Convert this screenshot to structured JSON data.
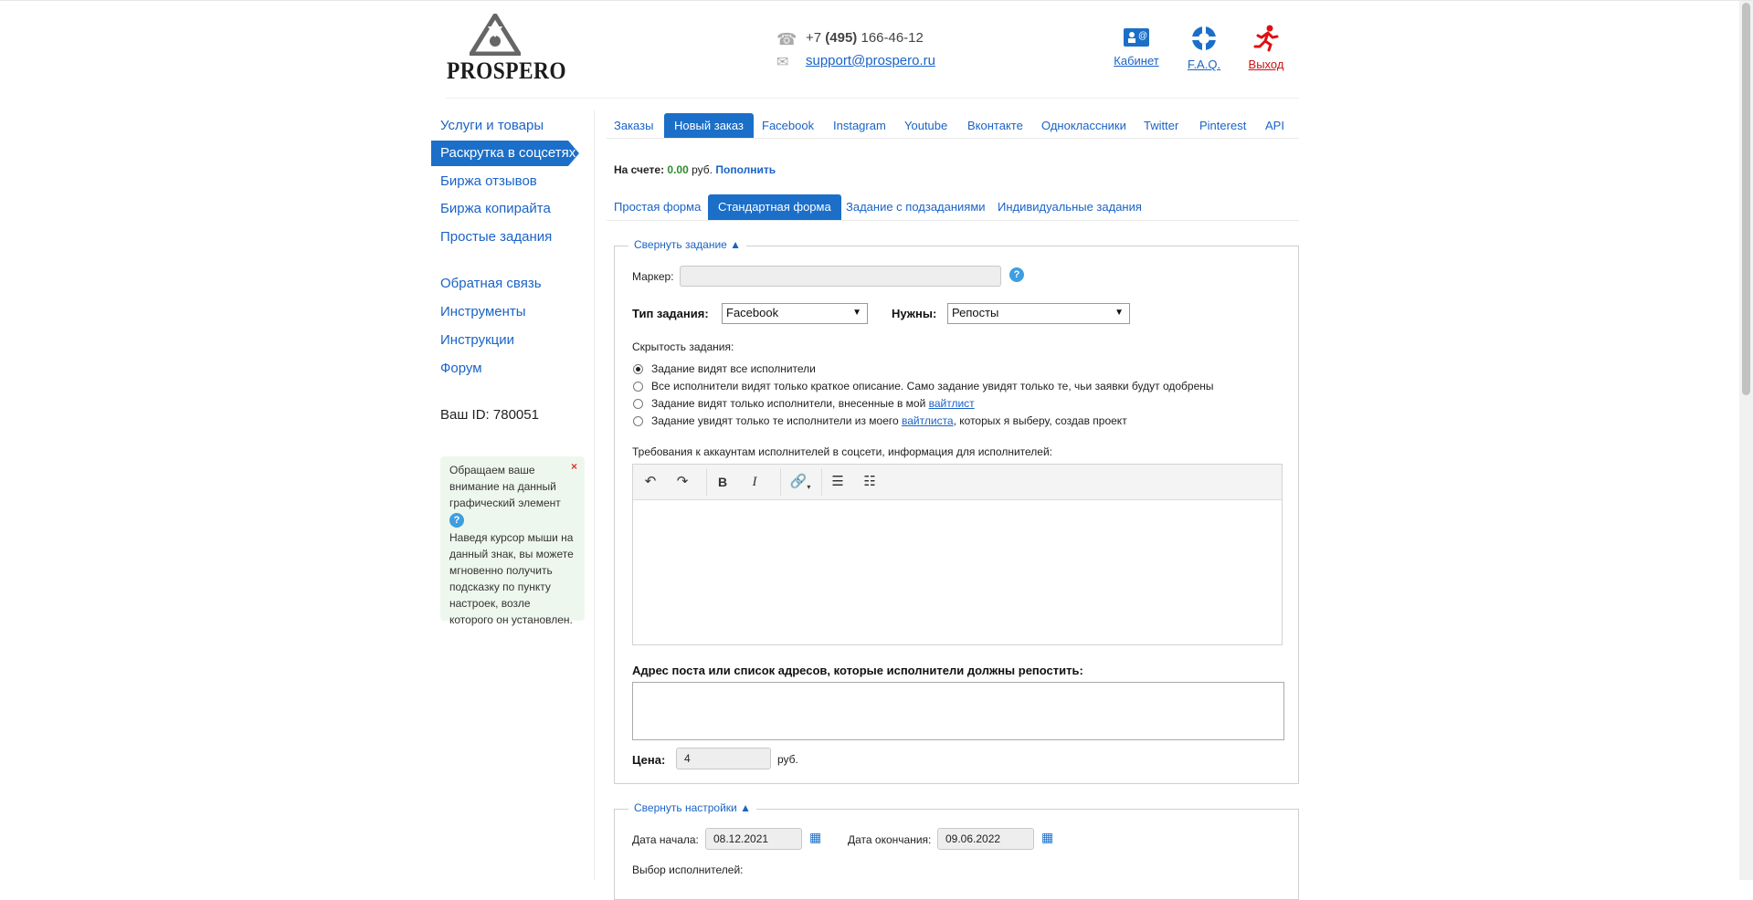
{
  "header": {
    "logo_text": "PROSPERO",
    "phone_prefix": "+7 ",
    "phone_code": "(495)",
    "phone_number": " 166-46-12",
    "email": "support@prospero.ru",
    "links": {
      "cabinet": "Кабинет",
      "faq": "F.A.Q.",
      "logout": "Выход"
    }
  },
  "sidebar": {
    "items": [
      "Услуги и товары",
      "Раскрутка в соцсетях",
      "Биржа отзывов",
      "Биржа копирайта",
      "Простые задания"
    ],
    "items2": [
      "Обратная связь",
      "Инструменты",
      "Инструкции",
      "Форум"
    ],
    "your_id": "Ваш ID: 780051",
    "tip_text": "Обращаем ваше внимание на данный графический элемент",
    "tip_body": "Наведя курсор мыши на данный знак, вы можете мгновенно получить подсказку по пункту настроек, возле которого он установлен.",
    "tip_close": "×"
  },
  "tabs": [
    "Заказы",
    "Новый заказ",
    "Facebook",
    "Instagram",
    "Youtube",
    "Вконтакте",
    "Одноклассники",
    "Twitter",
    "Pinterest",
    "API"
  ],
  "balance": {
    "label": "На счете:",
    "amount": "0.00",
    "currency": "руб.",
    "topup": "Пополнить"
  },
  "form_tabs": [
    "Простая форма",
    "Стандартная форма",
    "Задание с подзаданиями",
    "Индивидуальные задания"
  ],
  "task": {
    "legend": "Свернуть задание ▲",
    "marker_label": "Маркер:",
    "marker_value": "",
    "task_type_label": "Тип задания:",
    "task_type_value": "Facebook",
    "need_label": "Нужны:",
    "need_value": "Репосты",
    "visibility_label": "Скрытость задания:",
    "radios": [
      {
        "text": "Задание видят все исполнители",
        "link": "",
        "after": "",
        "checked": true
      },
      {
        "text": "Все исполнители видят только краткое описание. Само задание увидят только те, чьи заявки будут одобрены",
        "link": "",
        "after": "",
        "checked": false
      },
      {
        "text": "Задание видят только исполнители, внесенные в мой ",
        "link": "вайтлист",
        "after": "",
        "checked": false
      },
      {
        "text": "Задание увидят только те исполнители из моего ",
        "link": "вайтлиста",
        "after": ", которых я выберу, создав проект",
        "checked": false
      }
    ],
    "requirements_label": "Требования к аккаунтам исполнителей в соцсети, информация для исполнителей:",
    "repost_label": "Адрес поста или список адресов, которые исполнители должны репостить:",
    "price_label": "Цена:",
    "price_value": "4",
    "price_currency": "руб."
  },
  "settings": {
    "legend": "Свернуть настройки ▲",
    "start_label": "Дата начала:",
    "start_value": "08.12.2021",
    "end_label": "Дата окончания:",
    "end_value": "09.06.2022",
    "executors_label": "Выбор исполнителей:"
  },
  "colors": {
    "accent": "#1b6fc9",
    "link": "#1a63c7",
    "logout": "#cc1111",
    "balance_green": "#2e8b2e"
  }
}
